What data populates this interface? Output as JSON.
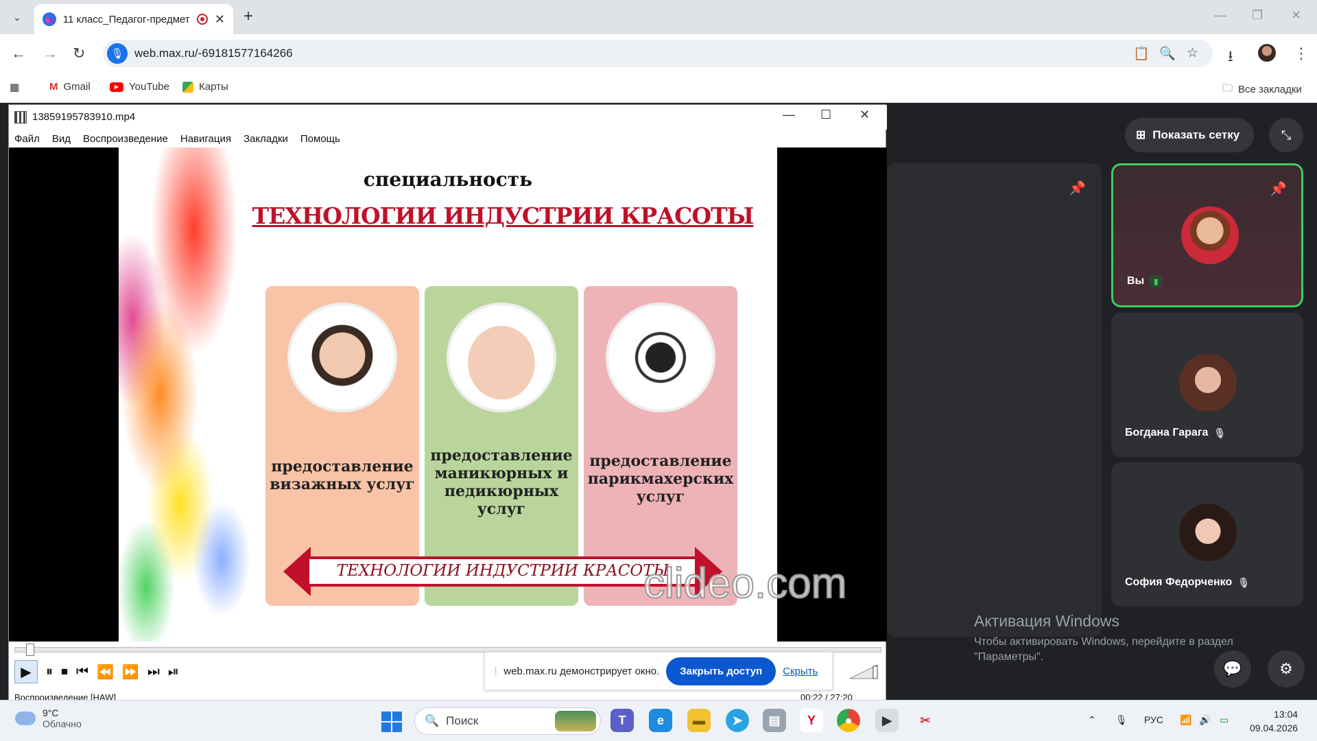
{
  "browser": {
    "tab_title": "11 класс_Педагог-предмет",
    "url": "web.max.ru/-69181577164266",
    "bookmarks": [
      {
        "label": "Gmail"
      },
      {
        "label": "YouTube"
      },
      {
        "label": "Карты"
      }
    ],
    "all_bookmarks": "Все закладки"
  },
  "player": {
    "file_title": "13859195783910.mp4",
    "menu": [
      "Файл",
      "Вид",
      "Воспроизведение",
      "Навигация",
      "Закладки",
      "Помощь"
    ],
    "status": "Воспроизведение [HAW]",
    "time": "00:22 / 27:20",
    "progress_fraction": 0.013
  },
  "slide": {
    "subtitle": "специальность",
    "title": "ТЕХНОЛОГИИ ИНДУСТРИИ КРАСОТЫ",
    "columns": [
      {
        "text": "предоставление визажных услуг",
        "color": "#f8c3a6"
      },
      {
        "text": "предоставление маникюрных и педикюрных услуг",
        "color": "#b9d59c"
      },
      {
        "text": "предоставление парикмахерских услуг",
        "color": "#eeb3b6"
      }
    ],
    "arrow_label": "ТЕХНОЛОГИИ ИНДУСТРИИ КРАСОТЫ",
    "watermark": "clideo.com"
  },
  "share_bar": {
    "message": "web.max.ru демонстрирует окно.",
    "stop_button": "Закрыть доступ",
    "hide_link": "Скрыть"
  },
  "call": {
    "show_grid": "Показать сетку",
    "participants": [
      {
        "name": "Вы",
        "active": true
      },
      {
        "name": "Богдана Гарага",
        "active": false
      },
      {
        "name": "София Федорченко",
        "active": false
      }
    ]
  },
  "windows_activation": {
    "heading": "Активация Windows",
    "text_line1": "Чтобы активировать Windows, перейдите в раздел",
    "text_line2": "\"Параметры\"."
  },
  "taskbar": {
    "weather_temp": "9°C",
    "weather_desc": "Облачно",
    "search_placeholder": "Поиск",
    "lang": "РУС",
    "time": "13:04",
    "date": "09.04.2026"
  }
}
